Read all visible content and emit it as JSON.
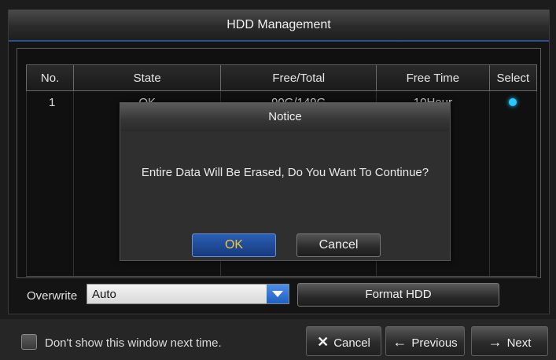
{
  "window": {
    "title": "HDD Management"
  },
  "table": {
    "headers": [
      "No.",
      "State",
      "Free/Total",
      "Free Time",
      "Select"
    ],
    "rows": [
      {
        "no": "1",
        "state": "OK",
        "free_total": "90G/149G",
        "free_time": "10Hour",
        "selected": true
      }
    ]
  },
  "overwrite": {
    "label": "Overwrite",
    "value": "Auto"
  },
  "format_button": "Format HDD",
  "footer": {
    "checkbox_label": "Don't show this window next time.",
    "cancel": "Cancel",
    "previous": "Previous",
    "next": "Next"
  },
  "dialog": {
    "title": "Notice",
    "message": "Entire Data Will Be Erased, Do You Want To Continue?",
    "ok": "OK",
    "cancel": "Cancel"
  },
  "colors": {
    "select_dot": "#29c8ff",
    "ok_text": "#f3c63a",
    "accent_blue": "#1f5fc2"
  },
  "icons": {
    "dropdown": "chevron-down-icon",
    "cancel": "x-icon",
    "previous": "arrow-left-icon",
    "next": "arrow-right-icon"
  }
}
